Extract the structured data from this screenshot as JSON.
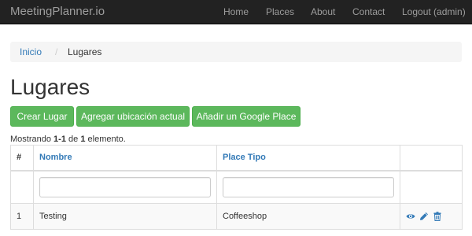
{
  "navbar": {
    "brand": "MeetingPlanner.io",
    "links": [
      "Home",
      "Places",
      "About",
      "Contact",
      "Logout (admin)"
    ]
  },
  "breadcrumb": {
    "home": "Inicio",
    "separator": "/",
    "current": "Lugares"
  },
  "page": {
    "title": "Lugares"
  },
  "buttons": {
    "create": "Crear Lugar",
    "add_current_location": "Agregar ubicación actual",
    "add_google_place": "Añadir un Google Place"
  },
  "summary": {
    "prefix": "Mostrando",
    "range": "1-1",
    "middle": "de",
    "total": "1",
    "suffix": "elemento."
  },
  "table": {
    "columns": [
      "#",
      "Nombre",
      "Place Tipo"
    ],
    "filters": {
      "nombre": "",
      "place_tipo": ""
    },
    "rows": [
      {
        "index": "1",
        "nombre": "Testing",
        "place_tipo": "Coffeeshop"
      }
    ]
  },
  "icons": [
    "eye-icon",
    "pencil-icon",
    "trash-icon"
  ],
  "colors": {
    "navbar_bg": "#222222",
    "navbar_text": "#9d9d9d",
    "link": "#337ab7",
    "success": "#5cb85c"
  }
}
